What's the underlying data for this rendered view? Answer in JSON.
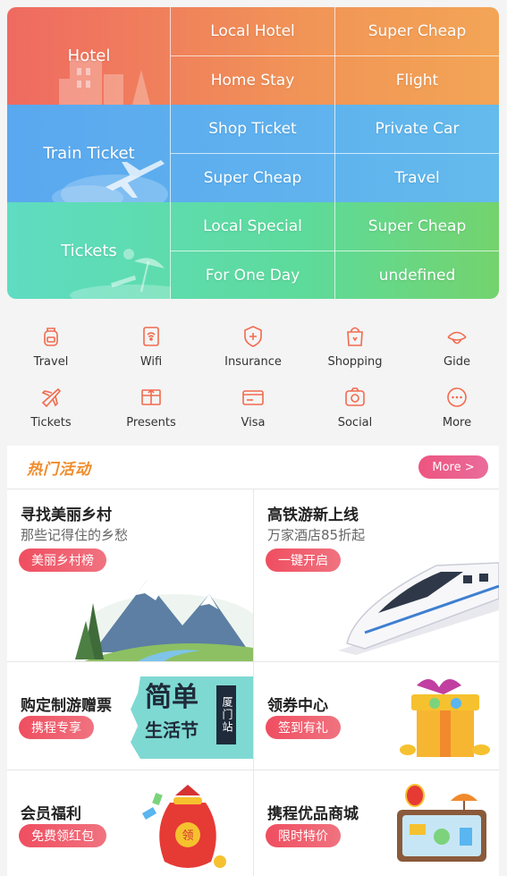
{
  "grid": {
    "rows": [
      {
        "main": "Hotel",
        "cells": [
          "Local Hotel",
          "Super Cheap",
          "Home Stay",
          "Flight"
        ]
      },
      {
        "main": "Train Ticket",
        "cells": [
          "Shop Ticket",
          "Private Car",
          "Super Cheap",
          "Travel"
        ]
      },
      {
        "main": "Tickets",
        "cells": [
          "Local Special",
          "Super Cheap",
          "For One Day",
          "undefined"
        ]
      }
    ]
  },
  "shortcuts": [
    {
      "label": "Travel",
      "icon": "backpack-icon"
    },
    {
      "label": "Wifi",
      "icon": "wifi-icon"
    },
    {
      "label": "Insurance",
      "icon": "shield-icon"
    },
    {
      "label": "Shopping",
      "icon": "shopping-bag-icon"
    },
    {
      "label": "Gide",
      "icon": "guide-hat-icon"
    },
    {
      "label": "Tickets",
      "icon": "airplane-icon"
    },
    {
      "label": "Presents",
      "icon": "gift-icon"
    },
    {
      "label": "Visa",
      "icon": "card-icon"
    },
    {
      "label": "Social",
      "icon": "camera-icon"
    },
    {
      "label": "More",
      "icon": "more-dots-icon"
    }
  ],
  "hot": {
    "title": "热门活动",
    "more": "More >"
  },
  "cards": [
    {
      "title": "寻找美丽乡村",
      "subtitle": "那些记得住的乡愁",
      "tag": "美丽乡村榜"
    },
    {
      "title": "高铁游新上线",
      "subtitle": "万家酒店85折起",
      "tag": "一键开启"
    },
    {
      "title": "购定制游赠票",
      "subtitle": "",
      "tag": "携程专享"
    },
    {
      "title": "领券中心",
      "subtitle": "",
      "tag": "签到有礼"
    },
    {
      "title": "会员福利",
      "subtitle": "",
      "tag": "免费领红包"
    },
    {
      "title": "携程优品商城",
      "subtitle": "",
      "tag": "限时特价"
    }
  ],
  "banner": {
    "line1": "简单",
    "line2": "生活节",
    "side": "厦门站"
  },
  "colors": {
    "accent_orange": "#f08b2a",
    "pill_red": "#ef4e60",
    "hotel_row": "#ef6a61",
    "train_row": "#5aa8ef",
    "tickets_row": "#5ddb9b"
  }
}
